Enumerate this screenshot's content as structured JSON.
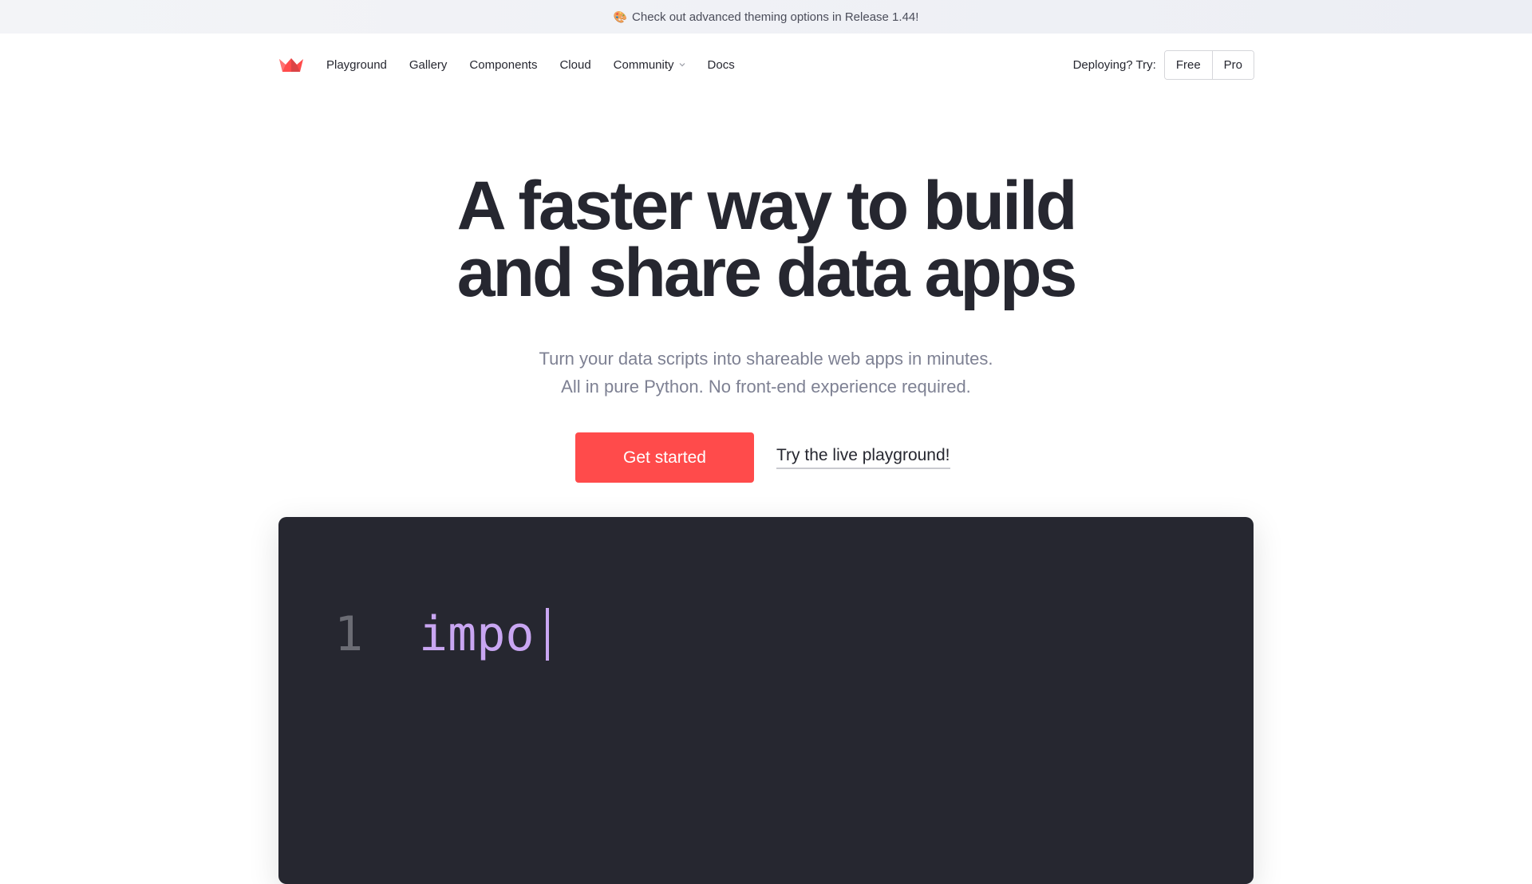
{
  "announcement": {
    "emoji": "🎨",
    "text": "Check out advanced theming options in Release 1.44!"
  },
  "nav": {
    "items": [
      {
        "label": "Playground"
      },
      {
        "label": "Gallery"
      },
      {
        "label": "Components"
      },
      {
        "label": "Cloud"
      },
      {
        "label": "Community",
        "dropdown": true
      },
      {
        "label": "Docs"
      }
    ],
    "deploy_label": "Deploying? Try:",
    "deploy_options": [
      "Free",
      "Pro"
    ]
  },
  "hero": {
    "title_line1": "A faster way to build",
    "title_line2": "and share data apps",
    "subtitle_line1": "Turn your data scripts into shareable web apps in minutes.",
    "subtitle_line2": "All in pure Python. No front-end experience required.",
    "primary_cta": "Get started",
    "secondary_cta": "Try the live playground!"
  },
  "code": {
    "line_number": "1",
    "text": "impo"
  },
  "colors": {
    "brand": "#ff4b4b",
    "text": "#262730",
    "muted": "#7e8193",
    "code_bg": "#262730",
    "code_keyword": "#c9a6f2"
  },
  "icons": {
    "logo": "streamlit-crown-logo",
    "dropdown": "chevron-down-icon"
  }
}
